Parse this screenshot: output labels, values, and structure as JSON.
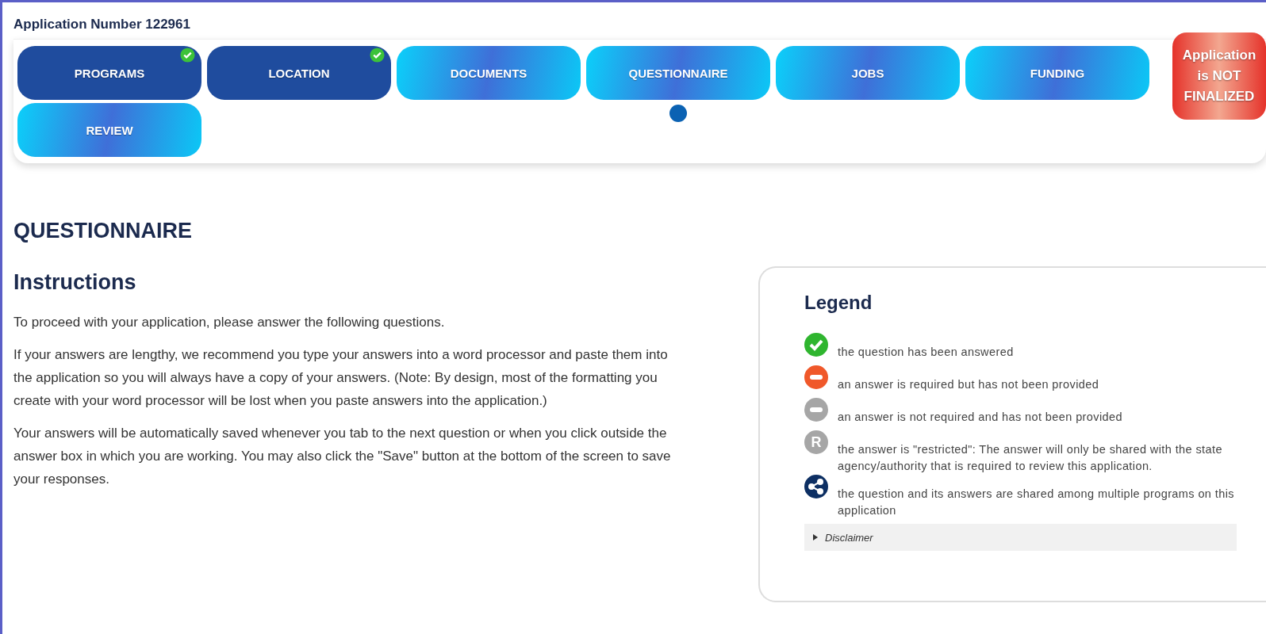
{
  "application_number": "Application Number 122961",
  "steps": [
    {
      "label": "PROGRAMS",
      "completed": true,
      "selected": false
    },
    {
      "label": "LOCATION",
      "completed": true,
      "selected": false
    },
    {
      "label": "DOCUMENTS",
      "completed": false,
      "selected": false
    },
    {
      "label": "QUESTIONNAIRE",
      "completed": false,
      "selected": true
    },
    {
      "label": "JOBS",
      "completed": false,
      "selected": false
    },
    {
      "label": "FUNDING",
      "completed": false,
      "selected": false
    },
    {
      "label": "REVIEW",
      "completed": false,
      "selected": false
    }
  ],
  "status_badge": "Application is NOT FINALIZED",
  "page_title": "QUESTIONNAIRE",
  "instructions": {
    "title": "Instructions",
    "paragraphs": [
      "To proceed with your application, please answer the following questions.",
      "If your answers are lengthy, we recommend you type your answers into a word processor and paste them into the application so you will always have a copy of your answers. (Note: By design, most of the formatting you create with your word processor will be lost when you paste answers into the application.)",
      "Your answers will be automatically saved whenever you tab to the next question or when you click outside the answer box in which you are working. You may also click the \"Save\" button at the bottom of the screen to save your responses."
    ]
  },
  "legend": {
    "title": "Legend",
    "items": [
      {
        "kind": "answered",
        "text": "the question has been answered"
      },
      {
        "kind": "required",
        "text": "an answer is required but has not been provided"
      },
      {
        "kind": "optional",
        "text": "an answer is not required and has not been provided"
      },
      {
        "kind": "restricted",
        "glyph": "R",
        "text": "the answer is \"restricted\": The answer will only be shared with the state agency/authority that is required to review this application."
      },
      {
        "kind": "shared",
        "text": "the question and its answers are shared among multiple programs on this application"
      }
    ],
    "disclaimer": {
      "label": "Disclaimer",
      "expanded": false
    }
  }
}
